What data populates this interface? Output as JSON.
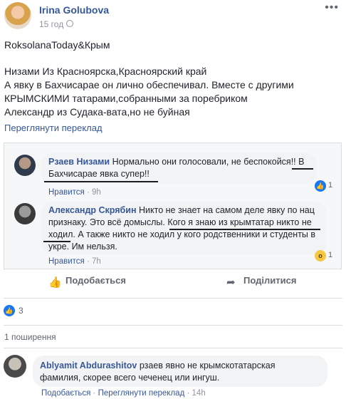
{
  "post": {
    "author": "Irina Golubova",
    "time": "15 год",
    "more_icon": "•••",
    "lines": [
      "RoksolanaToday&Крым",
      "Низами Из Красноярска,Красноярский край",
      "А явку в Бахчисарае он лично обеспечивал. Вместе с другими",
      "КРЫМСКИМИ татарами,собранными за поребриком",
      "Александр из Судака-вата,но не буйная"
    ],
    "translate": "Переглянути переклад"
  },
  "embedded": {
    "comment1": {
      "name": "Рзаев Низами",
      "text_a": "Нормально они голосовали, не беспокойся!!",
      "text_b": "В",
      "text_c": "Бахчисарае явка супер!!",
      "like": "Нравится",
      "time": "9h",
      "reactions": "1"
    },
    "comment2": {
      "name": "Александр Скрябин",
      "text_a": "Никто не знает на самом деле явку по нац",
      "text_b": "признаку. Это всё домыслы.",
      "text_c": "Кого я знаю из крымтатар никто не",
      "text_d": "ходил.",
      "text_e": "А также никто не ходил у кого родственники и студенты в",
      "text_f": "укре. Им нельзя.",
      "like": "Нравится",
      "time": "7h",
      "reactions": "1"
    }
  },
  "actions": {
    "share_label": "Поділитися",
    "like_label": "Подобається"
  },
  "likes_count": "3",
  "shares_text": "1 поширення",
  "comment": {
    "name": "Ablyamit Abdurashitov",
    "text_a": "рзаев явно не крымскотатарская",
    "text_b": "фамилия, скорее всего чеченец или ингуш.",
    "like": "Подобається",
    "translate": "Переглянути переклад",
    "time": "14h"
  },
  "colors": {
    "link": "#365899",
    "like_blue": "#1877f2"
  }
}
